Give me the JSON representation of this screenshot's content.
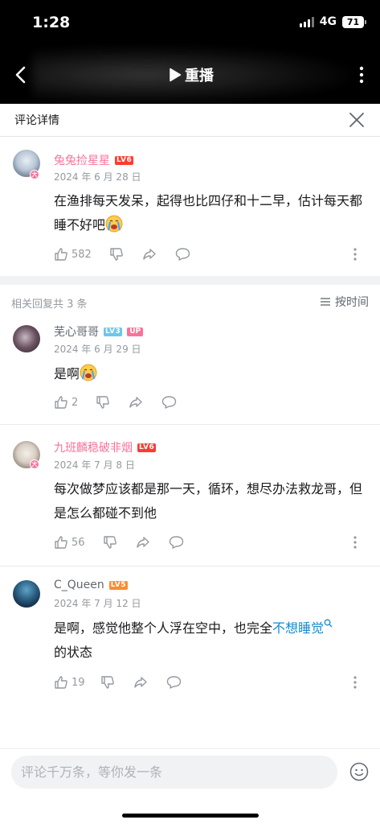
{
  "status_bar": {
    "time": "1:28",
    "network": "4G",
    "battery": "71"
  },
  "video_header": {
    "replay_label": "重播"
  },
  "panel": {
    "title": "评论详情"
  },
  "root_comment": {
    "username": "兔兔捡星星",
    "level": "LV6",
    "date": "2024 年 6 月 28 日",
    "text": "在渔排每天发呆，起得也比四仔和十二早，估计每天都睡不好吧",
    "likes": "582"
  },
  "replies_header": {
    "count_text": "相关回复共 3 条",
    "sort_label": "按时间"
  },
  "replies": [
    {
      "username": "芜心哥哥",
      "level": "LV3",
      "up_badge": "UP",
      "date": "2024 年 6 月 29 日",
      "text": "是啊",
      "likes": "2"
    },
    {
      "username": "九班麟稳破非烟",
      "level": "LV6",
      "date": "2024 年 7 月 8 日",
      "text": "每次做梦应该都是那一天，循环，想尽办法救龙哥，但是怎么都碰不到他",
      "likes": "56"
    },
    {
      "username": "C_Queen",
      "level": "LV5",
      "date": "2024 年 7 月 12 日",
      "text_before": "是啊，感觉他整个人浮在空中，也完全",
      "keyword": "不想睡觉",
      "text_after": "的状态",
      "likes": "19"
    }
  ],
  "bottom_bar": {
    "input_placeholder": "评论千万条，等你发一条"
  },
  "colors": {
    "vip_pink": "#fb7299",
    "link_blue": "#178bcf",
    "meta_grey": "#9499a0"
  }
}
